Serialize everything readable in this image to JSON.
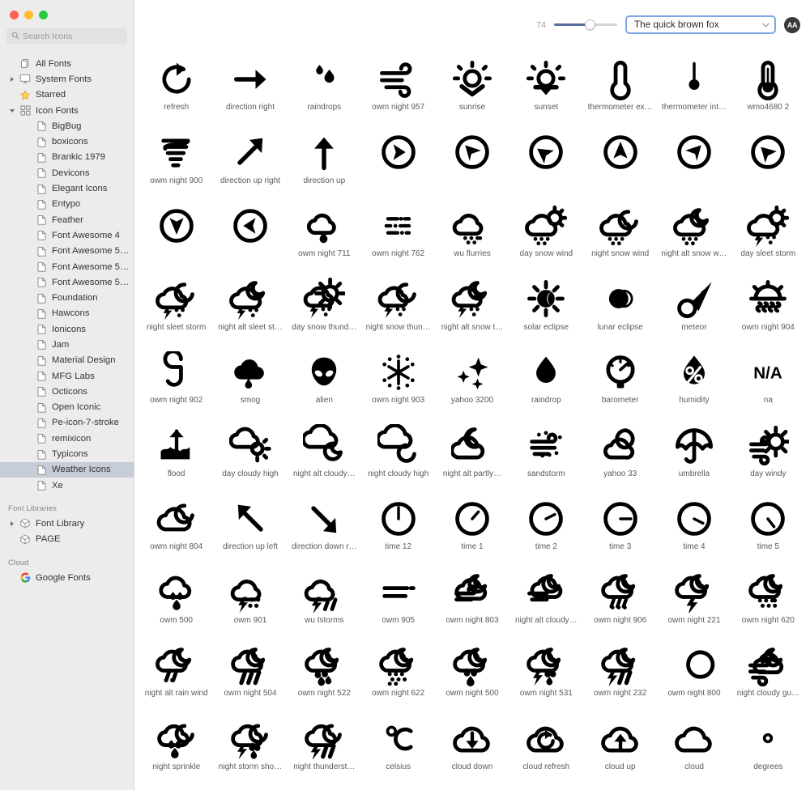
{
  "window": {
    "traffic_lights": [
      "close",
      "minimize",
      "zoom"
    ],
    "colors": {
      "close": "#ff5f57",
      "minimize": "#febc2e",
      "zoom": "#28c840",
      "selection": "#c6cdd6",
      "accent": "#7ba7e8"
    }
  },
  "search": {
    "placeholder": "Search Icons",
    "value": "",
    "icon": "search-icon"
  },
  "sidebar": {
    "items": [
      {
        "label": "All Fonts",
        "icon": "copy-icon",
        "indent": 0,
        "disclosure": "none",
        "selected": false
      },
      {
        "label": "System Fonts",
        "icon": "display-icon",
        "indent": 0,
        "disclosure": "collapsed",
        "selected": false
      },
      {
        "label": "Starred",
        "icon": "star-icon",
        "indent": 0,
        "disclosure": "none",
        "selected": false
      },
      {
        "label": "Icon Fonts",
        "icon": "grid-icon",
        "indent": 0,
        "disclosure": "expanded",
        "selected": false
      },
      {
        "label": "BigBug",
        "icon": "file-icon",
        "indent": 1,
        "disclosure": "none",
        "selected": false
      },
      {
        "label": "boxicons",
        "icon": "file-icon",
        "indent": 1,
        "disclosure": "none",
        "selected": false
      },
      {
        "label": "Brankic 1979",
        "icon": "file-icon",
        "indent": 1,
        "disclosure": "none",
        "selected": false
      },
      {
        "label": "Devicons",
        "icon": "file-icon",
        "indent": 1,
        "disclosure": "none",
        "selected": false
      },
      {
        "label": "Elegant Icons",
        "icon": "file-icon",
        "indent": 1,
        "disclosure": "none",
        "selected": false
      },
      {
        "label": "Entypo",
        "icon": "file-icon",
        "indent": 1,
        "disclosure": "none",
        "selected": false
      },
      {
        "label": "Feather",
        "icon": "file-icon",
        "indent": 1,
        "disclosure": "none",
        "selected": false
      },
      {
        "label": "Font Awesome 4",
        "icon": "file-icon",
        "indent": 1,
        "disclosure": "none",
        "selected": false
      },
      {
        "label": "Font Awesome 5 Brands",
        "icon": "file-icon",
        "indent": 1,
        "disclosure": "none",
        "selected": false
      },
      {
        "label": "Font Awesome 5 Free…",
        "icon": "file-icon",
        "indent": 1,
        "disclosure": "none",
        "selected": false
      },
      {
        "label": "Font Awesome 5 Free…",
        "icon": "file-icon",
        "indent": 1,
        "disclosure": "none",
        "selected": false
      },
      {
        "label": "Foundation",
        "icon": "file-icon",
        "indent": 1,
        "disclosure": "none",
        "selected": false
      },
      {
        "label": "Hawcons",
        "icon": "file-icon",
        "indent": 1,
        "disclosure": "none",
        "selected": false
      },
      {
        "label": "Ionicons",
        "icon": "file-icon",
        "indent": 1,
        "disclosure": "none",
        "selected": false
      },
      {
        "label": "Jam",
        "icon": "file-icon",
        "indent": 1,
        "disclosure": "none",
        "selected": false
      },
      {
        "label": "Material Design",
        "icon": "file-icon",
        "indent": 1,
        "disclosure": "none",
        "selected": false
      },
      {
        "label": "MFG Labs",
        "icon": "file-icon",
        "indent": 1,
        "disclosure": "none",
        "selected": false
      },
      {
        "label": "Octicons",
        "icon": "file-icon",
        "indent": 1,
        "disclosure": "none",
        "selected": false
      },
      {
        "label": "Open Iconic",
        "icon": "file-icon",
        "indent": 1,
        "disclosure": "none",
        "selected": false
      },
      {
        "label": "Pe-icon-7-stroke",
        "icon": "file-icon",
        "indent": 1,
        "disclosure": "none",
        "selected": false
      },
      {
        "label": "remixicon",
        "icon": "file-icon",
        "indent": 1,
        "disclosure": "none",
        "selected": false
      },
      {
        "label": "Typicons",
        "icon": "file-icon",
        "indent": 1,
        "disclosure": "none",
        "selected": false
      },
      {
        "label": "Weather Icons",
        "icon": "file-icon",
        "indent": 1,
        "disclosure": "none",
        "selected": true
      },
      {
        "label": "Xe",
        "icon": "file-icon",
        "indent": 1,
        "disclosure": "none",
        "selected": false
      }
    ],
    "groups": [
      {
        "title": "Font Libraries",
        "items": [
          {
            "label": "Font Library",
            "icon": "box-icon",
            "indent": 0,
            "disclosure": "collapsed",
            "selected": false
          },
          {
            "label": "PAGE",
            "icon": "box-icon",
            "indent": 0,
            "disclosure": "none",
            "selected": false
          }
        ]
      },
      {
        "title": "Cloud",
        "items": [
          {
            "label": "Google Fonts",
            "icon": "google-icon",
            "indent": 0,
            "disclosure": "none",
            "selected": false
          }
        ]
      }
    ]
  },
  "toolbar": {
    "size_value": "74",
    "slider_percent": 57,
    "sample_text": "The quick brown fox",
    "sample_chevron": "chevron-down-icon",
    "aa_label": "AA"
  },
  "grid": {
    "columns": 9,
    "icons": [
      {
        "name": "refresh",
        "glyph": "refresh"
      },
      {
        "name": "direction right",
        "glyph": "arrow-right"
      },
      {
        "name": "raindrops",
        "glyph": "raindrops"
      },
      {
        "name": "owm night 957",
        "glyph": "wind-strong"
      },
      {
        "name": "sunrise",
        "glyph": "sunrise"
      },
      {
        "name": "sunset",
        "glyph": "sunset"
      },
      {
        "name": "thermometer ex…",
        "glyph": "thermometer-empty"
      },
      {
        "name": "thermometer int…",
        "glyph": "thermometer-internal"
      },
      {
        "name": "wmo4680 2",
        "glyph": "thermometer-full"
      },
      {
        "name": "owm night 900",
        "glyph": "tornado"
      },
      {
        "name": "direction up right",
        "glyph": "arrow-up-right"
      },
      {
        "name": "direction up",
        "glyph": "arrow-up"
      },
      {
        "name": "",
        "glyph": "compass-e"
      },
      {
        "name": "",
        "glyph": "compass-ne"
      },
      {
        "name": "",
        "glyph": "compass-se"
      },
      {
        "name": "",
        "glyph": "compass-n"
      },
      {
        "name": "",
        "glyph": "compass-nw"
      },
      {
        "name": "",
        "glyph": "compass-se2"
      },
      {
        "name": "",
        "glyph": "compass-s"
      },
      {
        "name": "",
        "glyph": "compass-w"
      },
      {
        "name": "owm night 711",
        "glyph": "smoke"
      },
      {
        "name": "owm night 762",
        "glyph": "ash"
      },
      {
        "name": "wu flurries",
        "glyph": "cloud-snow"
      },
      {
        "name": "day snow wind",
        "glyph": "day-snow-wind"
      },
      {
        "name": "night snow wind",
        "glyph": "night-snow-wind"
      },
      {
        "name": "night alt snow w…",
        "glyph": "nightalt-snow-wind"
      },
      {
        "name": "day sleet storm",
        "glyph": "day-sleet-storm"
      },
      {
        "name": "night sleet storm",
        "glyph": "night-sleet-storm"
      },
      {
        "name": "night alt sleet st…",
        "glyph": "nightalt-sleet-storm"
      },
      {
        "name": "day snow thund…",
        "glyph": "day-snow-thunder"
      },
      {
        "name": "night snow thun…",
        "glyph": "night-snow-thunder"
      },
      {
        "name": "night alt snow t…",
        "glyph": "nightalt-snow-thunder"
      },
      {
        "name": "solar eclipse",
        "glyph": "solar-eclipse"
      },
      {
        "name": "lunar eclipse",
        "glyph": "lunar-eclipse"
      },
      {
        "name": "meteor",
        "glyph": "meteor"
      },
      {
        "name": "owm night 904",
        "glyph": "hot"
      },
      {
        "name": "owm night 902",
        "glyph": "hurricane"
      },
      {
        "name": "smog",
        "glyph": "smog"
      },
      {
        "name": "alien",
        "glyph": "alien"
      },
      {
        "name": "owm night 903",
        "glyph": "snowflake"
      },
      {
        "name": "yahoo 3200",
        "glyph": "sparkles"
      },
      {
        "name": "raindrop",
        "glyph": "raindrop"
      },
      {
        "name": "barometer",
        "glyph": "barometer"
      },
      {
        "name": "humidity",
        "glyph": "humidity"
      },
      {
        "name": "na",
        "glyph": "na"
      },
      {
        "name": "flood",
        "glyph": "flood"
      },
      {
        "name": "day cloudy high",
        "glyph": "day-cloudy-high"
      },
      {
        "name": "night alt cloudy…",
        "glyph": "nightalt-cloudy-high"
      },
      {
        "name": "night cloudy high",
        "glyph": "night-cloudy-high"
      },
      {
        "name": "night alt partly…",
        "glyph": "nightalt-partly-cloudy"
      },
      {
        "name": "sandstorm",
        "glyph": "sandstorm"
      },
      {
        "name": "yahoo 33",
        "glyph": "night-clear-cloud"
      },
      {
        "name": "umbrella",
        "glyph": "umbrella"
      },
      {
        "name": "day windy",
        "glyph": "day-windy"
      },
      {
        "name": "owm night 804",
        "glyph": "night-overcast"
      },
      {
        "name": "direction up left",
        "glyph": "arrow-up-left"
      },
      {
        "name": "direction down r…",
        "glyph": "arrow-down-right"
      },
      {
        "name": "time 12",
        "glyph": "clock-12"
      },
      {
        "name": "time 1",
        "glyph": "clock-1"
      },
      {
        "name": "time 2",
        "glyph": "clock-2"
      },
      {
        "name": "time 3",
        "glyph": "clock-3"
      },
      {
        "name": "time 4",
        "glyph": "clock-4"
      },
      {
        "name": "time 5",
        "glyph": "clock-5"
      },
      {
        "name": "owm 500",
        "glyph": "cloud-sprinkle"
      },
      {
        "name": "owm 901",
        "glyph": "cloud-storm-shower"
      },
      {
        "name": "wu tstorms",
        "glyph": "cloud-thunderstorm"
      },
      {
        "name": "owm 905",
        "glyph": "windy-lines"
      },
      {
        "name": "owm night 803",
        "glyph": "night-cloudy-windy"
      },
      {
        "name": "night alt cloudy…",
        "glyph": "nightalt-cloudy-windy"
      },
      {
        "name": "owm night 906",
        "glyph": "night-hail"
      },
      {
        "name": "owm night 221",
        "glyph": "night-lightning"
      },
      {
        "name": "owm night 620",
        "glyph": "night-snow-b"
      },
      {
        "name": "night alt rain wind",
        "glyph": "nightalt-rain-wind"
      },
      {
        "name": "owm night 504",
        "glyph": "night-rain-b"
      },
      {
        "name": "owm night 522",
        "glyph": "night-showers-b"
      },
      {
        "name": "owm night 622",
        "glyph": "night-snow-c"
      },
      {
        "name": "owm night 500",
        "glyph": "night-sprinkle-b"
      },
      {
        "name": "owm night 531",
        "glyph": "night-storm-showers-b"
      },
      {
        "name": "owm night 232",
        "glyph": "night-thunderstorm-b"
      },
      {
        "name": "owm night 800",
        "glyph": "moon-clear"
      },
      {
        "name": "night cloudy gu…",
        "glyph": "night-cloudy-gusts"
      },
      {
        "name": "night sprinkle",
        "glyph": "night-sprinkle"
      },
      {
        "name": "night storm sho…",
        "glyph": "night-storm-showers"
      },
      {
        "name": "night thunderst…",
        "glyph": "night-thunderstorm"
      },
      {
        "name": "celsius",
        "glyph": "celsius"
      },
      {
        "name": "cloud down",
        "glyph": "cloud-down"
      },
      {
        "name": "cloud refresh",
        "glyph": "cloud-refresh"
      },
      {
        "name": "cloud up",
        "glyph": "cloud-up"
      },
      {
        "name": "cloud",
        "glyph": "cloud"
      },
      {
        "name": "degrees",
        "glyph": "degrees"
      }
    ]
  }
}
